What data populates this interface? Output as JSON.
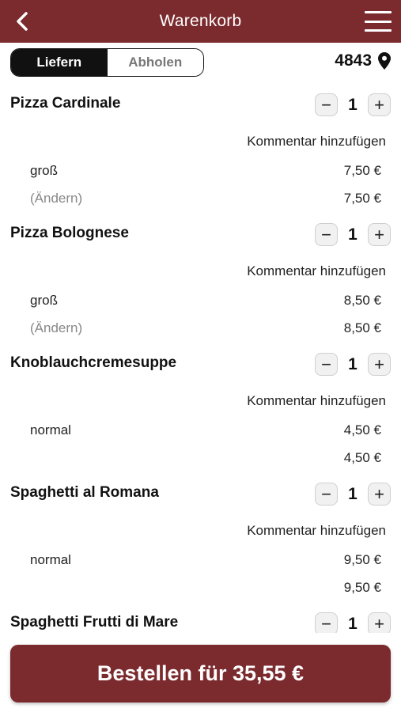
{
  "colors": {
    "brand": "#7b2a2e",
    "toggle_active": "#111111"
  },
  "header": {
    "title": "Warenkorb",
    "back_icon": "chevron-left-icon",
    "menu_icon": "hamburger-menu-icon"
  },
  "mode": {
    "options": [
      "Liefern",
      "Abholen"
    ],
    "selected": "Liefern"
  },
  "location": {
    "zip": "4843",
    "icon": "map-pin-icon"
  },
  "items": [
    {
      "name": "Pizza Cardinale",
      "qty": "1",
      "comment": "Kommentar hinzufügen",
      "option": "groß",
      "option_price": "7,50 €",
      "secondary": "(Ändern)",
      "total": "7,50 €"
    },
    {
      "name": "Pizza Bolognese",
      "qty": "1",
      "comment": "Kommentar hinzufügen",
      "option": "groß",
      "option_price": "8,50 €",
      "secondary": "(Ändern)",
      "total": "8,50 €"
    },
    {
      "name": "Knoblauchcremesuppe",
      "qty": "1",
      "comment": "Kommentar hinzufügen",
      "option": "normal",
      "option_price": "4,50 €",
      "secondary": "",
      "total": "4,50 €"
    },
    {
      "name": "Spaghetti al Romana",
      "qty": "1",
      "comment": "Kommentar hinzufügen",
      "option": "normal",
      "option_price": "9,50 €",
      "secondary": "",
      "total": "9,50 €"
    },
    {
      "name": "Spaghetti Frutti di Mare",
      "qty": "1",
      "comment": "",
      "option": "",
      "option_price": "",
      "secondary": "",
      "total": ""
    }
  ],
  "qty_controls": {
    "minus": "−",
    "plus": "+"
  },
  "order_button": {
    "label": "Bestellen für 35,55 €"
  }
}
